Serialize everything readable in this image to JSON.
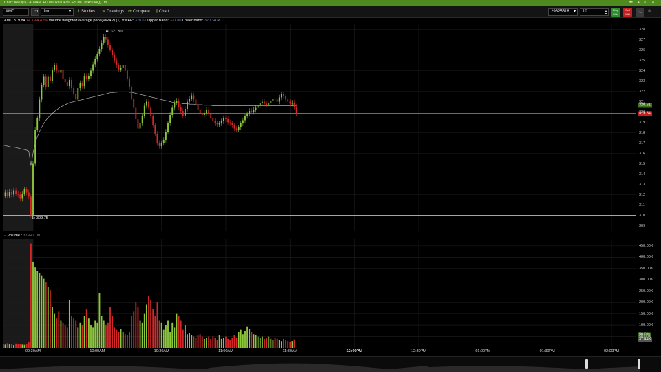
{
  "window": {
    "title": "Chart: AMD(1) - ADVANCED MICRO DEVICES INC (NASDAQ) 1m",
    "controls": "✚ ▪ ▫ ✕"
  },
  "toolbar": {
    "symbol": "AMD",
    "mode": "ch",
    "interval": "1m",
    "studies_label": "Studies",
    "drawings_label": "Drawings",
    "compare_label": "Compare",
    "chart_label": "Chart",
    "account": "29625518",
    "quantity": "10",
    "buy_label": "Buy Mkt",
    "sell_label": "Sell Mkt",
    "flat_label": "Flat"
  },
  "infobar": {
    "symbol": "AMD",
    "last": "319.84",
    "change": "14.79",
    "pct": "4.42%",
    "study": "Volume weighted average price(VWAP) (1) VWAP:",
    "vwap": "320.61",
    "upper_label": "Upper Band:",
    "upper": "321.80",
    "lower_label": "Lower band:",
    "lower": "320.34"
  },
  "volume_header": {
    "label": "Volume",
    "value": "37,441.00"
  },
  "annotations": {
    "high": "H: 327.50",
    "low": "L: 309.75"
  },
  "price_tags": {
    "vwap": "320.61",
    "last": "319.84"
  },
  "volume_tags": {
    "pct": "50.0%",
    "last": "37.44K"
  },
  "colors": {
    "up": "#8dc83c",
    "down": "#d42828",
    "vwap": "#b0b0b0",
    "accent": "#4f8a1e"
  },
  "chart_data": [
    {
      "type": "candlestick",
      "x_ticks": [
        "09:30AM",
        "10:00AM",
        "10:30AM",
        "11:00AM",
        "11:30AM",
        "12:00PM",
        "12:30PM",
        "01:00PM",
        "01:30PM",
        "02:00PM"
      ],
      "x_tick_times": [
        "09:30",
        "10:00",
        "10:30",
        "11:00",
        "11:30",
        "12:00",
        "12:30",
        "13:00",
        "13:30",
        "14:00"
      ],
      "ylim": [
        308.5,
        328.5
      ],
      "y_ticks": [
        309,
        310,
        311,
        312,
        313,
        314,
        315,
        316,
        317,
        318,
        319,
        320,
        321,
        322,
        323,
        324,
        325,
        326,
        327,
        328
      ],
      "horizontal_lines": [
        319.84,
        310.0
      ],
      "series": [
        {
          "name": "AMD",
          "time_start": "09:16",
          "interval_minutes": 1,
          "close": [
            311.9,
            312.2,
            311.9,
            312.3,
            312.0,
            312.4,
            312.1,
            312.0,
            311.6,
            312.1,
            312.5,
            312.2,
            311.8,
            310.0,
            315.0,
            318.3,
            319.4,
            321.2,
            322.6,
            323.4,
            322.4,
            323.4,
            323.0,
            324.1,
            324.5,
            324.0,
            323.8,
            324.1,
            323.2,
            322.9,
            322.5,
            323.1,
            322.3,
            321.7,
            321.2,
            322.3,
            322.8,
            322.5,
            323.5,
            323.2,
            323.5,
            324.0,
            324.6,
            325.1,
            325.6,
            326.1,
            326.7,
            327.3,
            327.0,
            326.5,
            326.0,
            325.5,
            325.0,
            324.5,
            324.1,
            324.3,
            324.5,
            324.0,
            323.2,
            322.4,
            321.3,
            320.4,
            319.3,
            318.4,
            318.9,
            319.6,
            320.6,
            321.0,
            320.4,
            319.6,
            318.7,
            317.9,
            317.0,
            316.7,
            317.0,
            317.3,
            318.1,
            318.9,
            319.7,
            320.4,
            320.9,
            321.1,
            320.5,
            320.1,
            319.6,
            320.3,
            321.0,
            321.3,
            321.6,
            321.2,
            320.7,
            320.2,
            319.8,
            319.7,
            319.9,
            320.2,
            319.8,
            319.4,
            319.1,
            318.9,
            318.8,
            318.9,
            319.1,
            319.4,
            319.3,
            319.0,
            318.9,
            318.7,
            318.4,
            318.3,
            318.5,
            318.9,
            319.2,
            319.6,
            319.8,
            320.1,
            320.0,
            320.2,
            320.4,
            320.6,
            320.9,
            321.0,
            320.8,
            320.7,
            320.9,
            321.1,
            321.3,
            321.2,
            321.0,
            321.4,
            321.7,
            321.5,
            321.2,
            321.0,
            320.8,
            320.9,
            320.5,
            319.84
          ]
        }
      ]
    },
    {
      "type": "line",
      "name": "VWAP",
      "time_start": "09:16",
      "interval_minutes": 1,
      "values": [
        316.8,
        316.75,
        316.7,
        316.65,
        316.6,
        316.6,
        316.55,
        316.5,
        316.45,
        316.4,
        316.35,
        316.3,
        316.2,
        314.8,
        316.0,
        317.0,
        317.6,
        318.1,
        318.5,
        318.9,
        319.2,
        319.45,
        319.65,
        319.85,
        320.05,
        320.2,
        320.35,
        320.5,
        320.6,
        320.7,
        320.8,
        320.9,
        320.95,
        321.0,
        321.05,
        321.1,
        321.15,
        321.2,
        321.25,
        321.3,
        321.35,
        321.4,
        321.45,
        321.5,
        321.55,
        321.6,
        321.65,
        321.7,
        321.75,
        321.8,
        321.85,
        321.85,
        321.9,
        321.9,
        321.95,
        321.95,
        321.95,
        321.95,
        321.95,
        321.9,
        321.9,
        321.85,
        321.8,
        321.75,
        321.7,
        321.65,
        321.6,
        321.55,
        321.5,
        321.45,
        321.4,
        321.35,
        321.3,
        321.25,
        321.2,
        321.15,
        321.1,
        321.05,
        321.0,
        320.95,
        320.9,
        320.9,
        320.85,
        320.85,
        320.8,
        320.8,
        320.8,
        320.75,
        320.75,
        320.75,
        320.7,
        320.7,
        320.7,
        320.7,
        320.65,
        320.65,
        320.65,
        320.65,
        320.6,
        320.6,
        320.6,
        320.6,
        320.6,
        320.6,
        320.6,
        320.6,
        320.6,
        320.6,
        320.6,
        320.6,
        320.6,
        320.6,
        320.6,
        320.6,
        320.6,
        320.6,
        320.6,
        320.6,
        320.6,
        320.6,
        320.6,
        320.6,
        320.6,
        320.6,
        320.6,
        320.6,
        320.6,
        320.6,
        320.6,
        320.6,
        320.6,
        320.6,
        320.6,
        320.6,
        320.6,
        320.6,
        320.6,
        320.61
      ]
    },
    {
      "type": "bar",
      "name": "Volume",
      "ylim": [
        0,
        480000
      ],
      "y_ticks": [
        "450.00K",
        "400.00K",
        "350.00K",
        "300.00K",
        "250.00K",
        "200.00K",
        "150.00K",
        "100.00K",
        "50.00K"
      ],
      "y_tick_values": [
        450000,
        400000,
        350000,
        300000,
        250000,
        200000,
        150000,
        100000,
        50000
      ],
      "values": [
        18000,
        14000,
        20000,
        15000,
        17000,
        12000,
        19000,
        15000,
        16000,
        14000,
        13000,
        17000,
        24000,
        460000,
        380000,
        355000,
        340000,
        330000,
        320000,
        305000,
        290000,
        270000,
        255000,
        180000,
        150000,
        130000,
        160000,
        120000,
        110000,
        100000,
        90000,
        210000,
        140000,
        130000,
        120000,
        90000,
        110000,
        100000,
        140000,
        170000,
        130000,
        100000,
        90000,
        120000,
        110000,
        240000,
        140000,
        120000,
        100000,
        110000,
        180000,
        140000,
        90000,
        80000,
        70000,
        85000,
        70000,
        60000,
        55000,
        70000,
        140000,
        160000,
        200000,
        180000,
        120000,
        110000,
        150000,
        190000,
        230000,
        210000,
        170000,
        140000,
        200000,
        120000,
        110000,
        80000,
        100000,
        120000,
        70000,
        110000,
        90000,
        150000,
        140000,
        120000,
        80000,
        100000,
        60000,
        65000,
        55000,
        50000,
        45000,
        55000,
        60000,
        50000,
        40000,
        45000,
        50000,
        40000,
        50000,
        45000,
        35000,
        55000,
        40000,
        45000,
        50000,
        40000,
        35000,
        45000,
        55000,
        45000,
        70000,
        80000,
        60000,
        75000,
        95000,
        85000,
        70000,
        60000,
        55000,
        50000,
        45000,
        50000,
        40000,
        45000,
        50000,
        40000,
        35000,
        45000,
        40000,
        35000,
        30000,
        40000,
        35000,
        30000,
        25000,
        30000,
        37441
      ]
    }
  ]
}
